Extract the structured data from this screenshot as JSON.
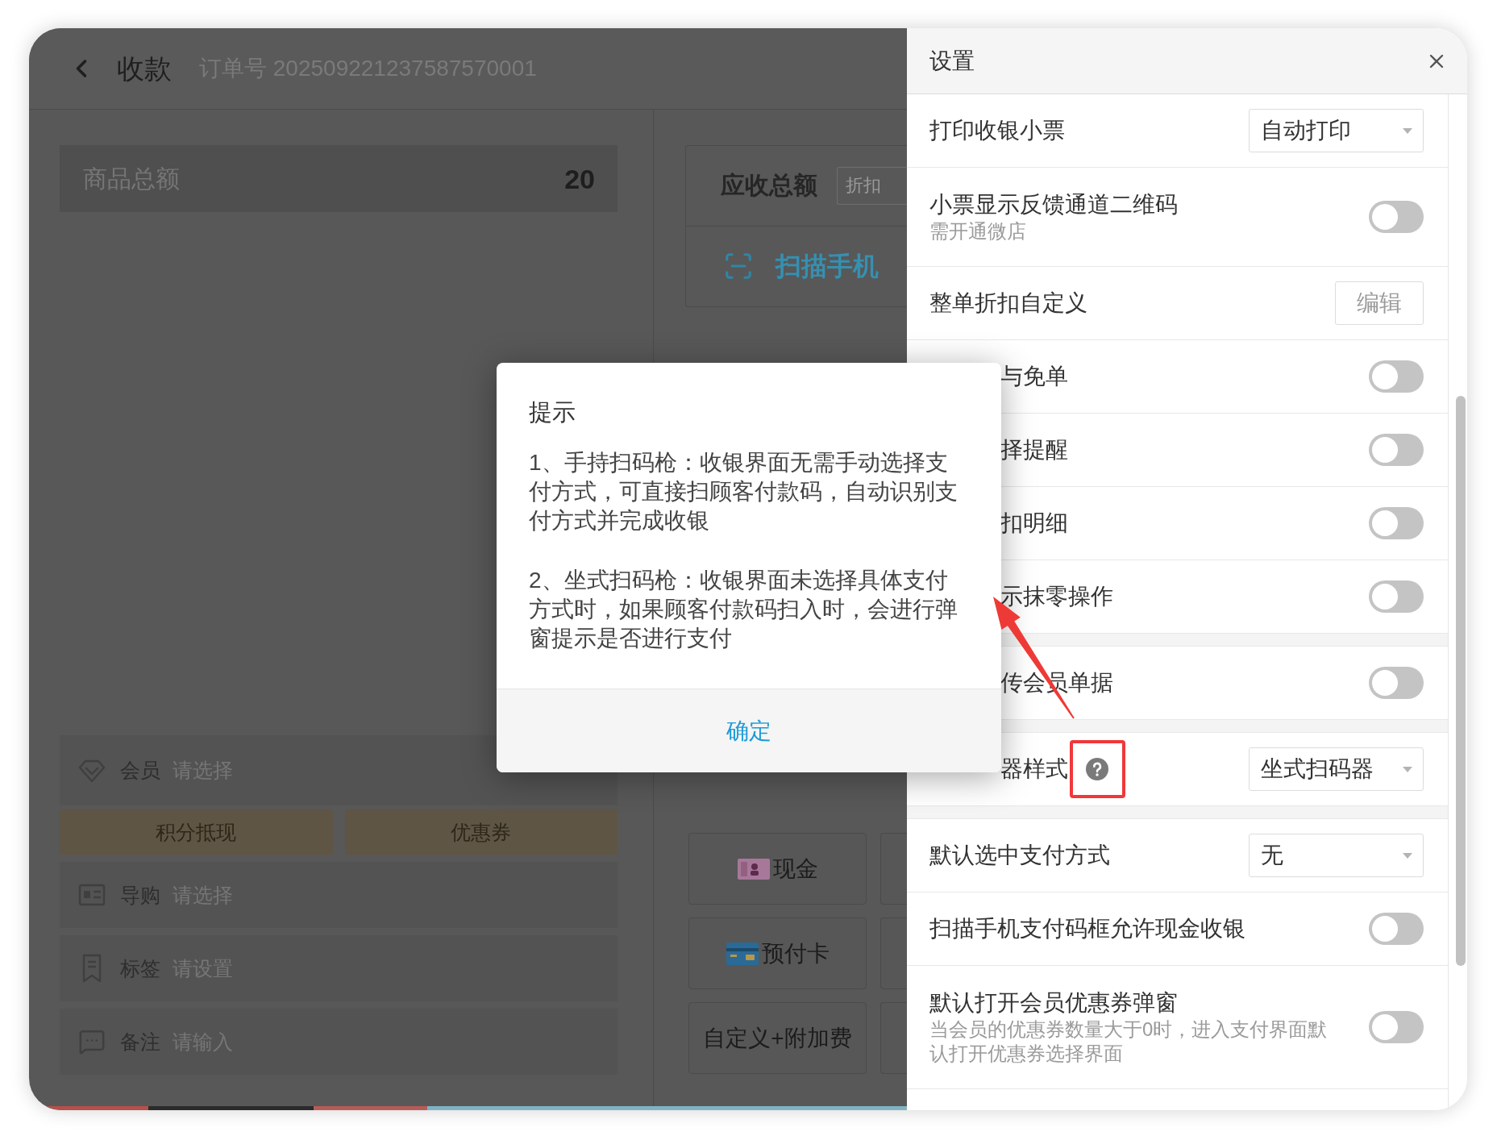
{
  "header": {
    "title": "收款",
    "order_number": "订单号 202509221237587570001"
  },
  "summary": {
    "label": "商品总额",
    "value": "20"
  },
  "member": {
    "label": "会员",
    "placeholder": "请选择"
  },
  "discount_buttons": [
    "积分抵现",
    "优惠券"
  ],
  "fields": [
    {
      "kind": "staff",
      "label": "导购",
      "placeholder": "请选择"
    },
    {
      "kind": "tag",
      "label": "标签",
      "placeholder": "请设置"
    },
    {
      "kind": "note",
      "label": "备注",
      "placeholder": "请输入"
    }
  ],
  "payment": {
    "due_label": "应收总额",
    "discount_tag": "折扣",
    "scan_label": "扫描手机",
    "methods": [
      {
        "kind": "cash",
        "label": "现金"
      },
      {
        "kind": "card",
        "label": "预付卡"
      },
      {
        "kind": "plain",
        "label": "自定义+附加费"
      }
    ]
  },
  "settings": {
    "title": "设置",
    "groups": [
      {
        "rows": [
          {
            "label": "打印收银小票",
            "control": {
              "kind": "select",
              "value": "自动打印"
            }
          },
          {
            "label": "小票显示反馈通道二维码",
            "note": "需开通微店",
            "control": {
              "kind": "toggle",
              "on": false
            }
          },
          {
            "label": "整单折扣自定义",
            "control": {
              "kind": "button",
              "label": "编辑"
            }
          },
          {
            "label": "与免单",
            "covered": true,
            "control": {
              "kind": "toggle",
              "on": false
            }
          },
          {
            "label": "择提醒",
            "covered": true,
            "control": {
              "kind": "toggle",
              "on": false
            }
          },
          {
            "label": "扣明细",
            "covered": true,
            "control": {
              "kind": "toggle",
              "on": false
            }
          },
          {
            "label": "示抹零操作",
            "covered": true,
            "control": {
              "kind": "toggle",
              "on": false
            }
          }
        ]
      },
      {
        "rows": [
          {
            "label": "传会员单据",
            "covered": true,
            "control": {
              "kind": "toggle",
              "on": false
            }
          }
        ]
      },
      {
        "rows": [
          {
            "label": "器样式",
            "covered": true,
            "help": true,
            "highlighted": true,
            "control": {
              "kind": "select",
              "value": "坐式扫码器"
            }
          }
        ]
      },
      {
        "rows": [
          {
            "label": "默认选中支付方式",
            "control": {
              "kind": "select",
              "value": "无"
            }
          },
          {
            "label": "扫描手机支付码框允许现金收银",
            "control": {
              "kind": "toggle",
              "on": false
            }
          },
          {
            "label": "默认打开会员优惠券弹窗",
            "note": "当会员的优惠券数量大于0时，进入支付界面默认打开优惠券选择界面",
            "control": {
              "kind": "toggle",
              "on": false
            }
          }
        ]
      }
    ]
  },
  "dialog": {
    "title": "提示",
    "paragraphs": [
      "1、手持扫码枪：收银界面无需手动选择支付方式，可直接扫顾客付款码，自动识别支付方式并完成收银",
      "2、坐式扫码枪：收银界面未选择具体支付方式时，如果顾客付款码扫入时，会进行弹窗提示是否进行支付"
    ],
    "confirm": "确定"
  }
}
